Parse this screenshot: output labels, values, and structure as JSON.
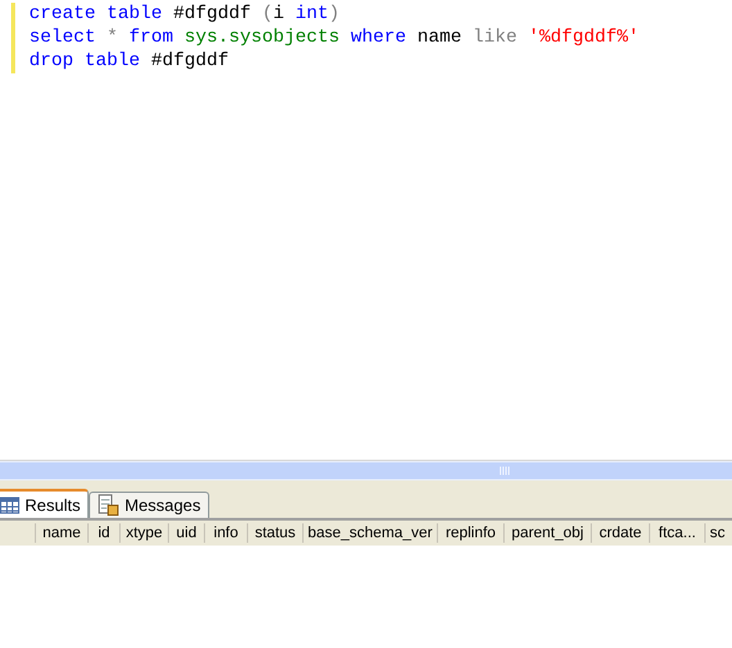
{
  "editor": {
    "lines": [
      [
        {
          "kind": "keyword",
          "text": "create table"
        },
        {
          "kind": "plain",
          "text": " #dfgddf "
        },
        {
          "kind": "operator",
          "text": "("
        },
        {
          "kind": "plain",
          "text": "i "
        },
        {
          "kind": "keyword",
          "text": "int"
        },
        {
          "kind": "operator",
          "text": ")"
        }
      ],
      [
        {
          "kind": "keyword",
          "text": "select"
        },
        {
          "kind": "operator",
          "text": " * "
        },
        {
          "kind": "keyword",
          "text": "from"
        },
        {
          "kind": "system",
          "text": " sys.sysobjects "
        },
        {
          "kind": "keyword",
          "text": "where"
        },
        {
          "kind": "plain",
          "text": " name "
        },
        {
          "kind": "operator",
          "text": "like"
        },
        {
          "kind": "string",
          "text": " '%dfgddf%'"
        }
      ],
      [
        {
          "kind": "keyword",
          "text": "drop table"
        },
        {
          "kind": "plain",
          "text": " #dfgddf"
        }
      ]
    ]
  },
  "tabs": [
    {
      "label": "Results",
      "selected": true
    },
    {
      "label": "Messages",
      "selected": false
    }
  ],
  "table": {
    "columns": [
      "name",
      "id",
      "xtype",
      "uid",
      "info",
      "status",
      "base_schema_ver",
      "replinfo",
      "parent_obj",
      "crdate",
      "ftca...",
      "sc"
    ]
  }
}
